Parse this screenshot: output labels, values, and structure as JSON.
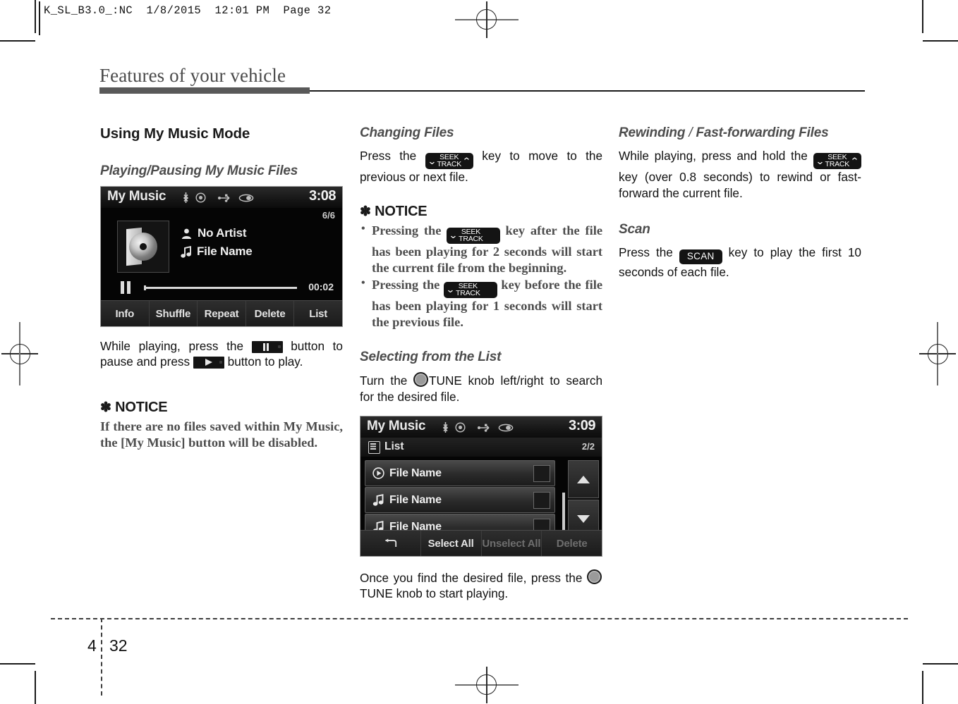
{
  "prepress": {
    "header": "K_SL_B3.0_:NC  1/8/2015  12:01 PM  Page 32"
  },
  "page": {
    "chapter_title": "Features of your vehicle",
    "footer_chapter": "4",
    "footer_page": "32"
  },
  "col1": {
    "section_title": "Using My Music Mode",
    "sub1_title": "Playing/Pausing My Music Files",
    "screenshot1": {
      "title": "My Music",
      "clock": "3:08",
      "count": "6/6",
      "artist": "No Artist",
      "file": "File Name",
      "elapsed": "00:02",
      "buttons": [
        "Info",
        "Shuffle",
        "Repeat",
        "Delete",
        "List"
      ]
    },
    "para1_a": "While playing, press the",
    "para1_b": "button to pause and press",
    "para1_c": "button to play.",
    "notice_label": "NOTICE",
    "notice_star": "✽",
    "notice_text": "If there are no files saved within My Music, the [My Music] button will be disabled."
  },
  "col2": {
    "sub1_title": "Changing Files",
    "para1_a": "Press the",
    "para1_b": "key to move to the previous or next file.",
    "notice_label": "NOTICE",
    "notice_star": "✽",
    "notice_items": [
      {
        "a": "Pressing the",
        "b": "key after the file has been playing for 2 seconds will start the current file from the beginning."
      },
      {
        "a": "Pressing the",
        "b": "key before the file has been playing for 1 seconds will start the previous file."
      }
    ],
    "sub2_title": "Selecting from the List",
    "para2_a": "Turn the",
    "para2_b": "TUNE knob left/right to search for the desired file.",
    "screenshot2": {
      "title": "My Music",
      "clock": "3:09",
      "list_label": "List",
      "count": "2/2",
      "rows": [
        "File Name",
        "File Name",
        "File Name"
      ],
      "buttons": [
        "Select All",
        "Unselect All",
        "Delete"
      ]
    },
    "para3_a": "Once you find the desired file, press the",
    "para3_b": "TUNE knob to start playing."
  },
  "col3": {
    "sub1_title_a": "Rewinding",
    "sub1_title_sep": "/",
    "sub1_title_b": "Fast-forwarding Files",
    "para1_a": "While playing, press and hold the",
    "para1_b": "key (over 0.8 seconds) to rewind or fast-forward the current file.",
    "sub2_title": "Scan",
    "para2_a": "Press the",
    "para2_b": "key to play the first 10 seconds of each file."
  },
  "keys": {
    "seek_top": "SEEK",
    "seek_bottom": "TRACK",
    "chev_left": "⌄",
    "chev_right": "⌃",
    "scan": "SCAN"
  },
  "colors": {
    "key_black": "#141414",
    "title_bar": "#595959",
    "notice_gray": "#4d4d4d",
    "subhead_gray": "#4d4d4d"
  }
}
